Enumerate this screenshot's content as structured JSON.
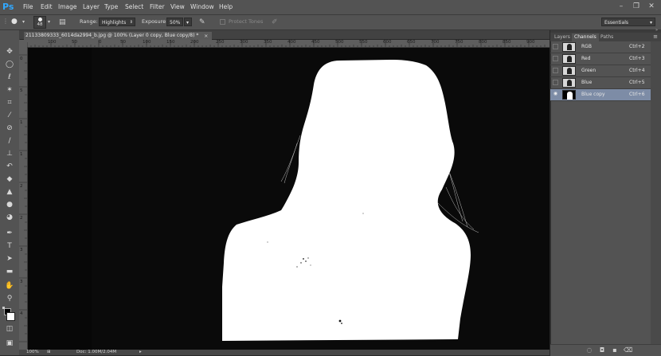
{
  "app": {
    "logo": "Ps",
    "menu": [
      "File",
      "Edit",
      "Image",
      "Layer",
      "Type",
      "Select",
      "Filter",
      "View",
      "Window",
      "Help"
    ],
    "window_controls": [
      "minimize-icon",
      "restore-icon",
      "close-icon"
    ]
  },
  "options_bar": {
    "brush_size": "48",
    "range_label": "Range:",
    "range_value": "Highlights",
    "exposure_label": "Exposure:",
    "exposure_value": "50%",
    "protect_tones_label": "Protect Tones",
    "workspace": "Essentials"
  },
  "document": {
    "tab_title": "21133809333_6014da2994_b.jpg @ 100% (Layer 0 copy, Blue copy/8) *",
    "close": "×",
    "zoom": "100%",
    "doc_info": "Doc: 1.00M/2.04M"
  },
  "ruler": {
    "top_ticks": [
      "100",
      "50",
      "0",
      "50",
      "100",
      "150",
      "200",
      "250",
      "300",
      "350",
      "400",
      "450",
      "500",
      "550",
      "600",
      "650",
      "700",
      "750",
      "800",
      "850",
      "900",
      "950"
    ],
    "left_ticks": [
      "0",
      "5",
      "1",
      "1",
      "2",
      "2",
      "3",
      "3",
      "4"
    ]
  },
  "tools": [
    "move-icon",
    "marquee-icon",
    "lasso-icon",
    "quick-select-icon",
    "crop-icon",
    "eyedropper-icon",
    "healing-icon",
    "brush-icon",
    "clone-stamp-icon",
    "history-brush-icon",
    "eraser-icon",
    "gradient-icon",
    "blur-icon",
    "dodge-icon",
    "pen-icon",
    "type-icon",
    "path-select-icon",
    "shape-icon",
    "hand-icon",
    "zoom-icon"
  ],
  "panel": {
    "tabs": [
      "Layers",
      "Channels",
      "Paths"
    ],
    "active_tab": "Channels",
    "channels": [
      {
        "name": "RGB",
        "shortcut": "Ctrl+2",
        "visible": false,
        "selected": false
      },
      {
        "name": "Red",
        "shortcut": "Ctrl+3",
        "visible": false,
        "selected": false
      },
      {
        "name": "Green",
        "shortcut": "Ctrl+4",
        "visible": false,
        "selected": false
      },
      {
        "name": "Blue",
        "shortcut": "Ctrl+5",
        "visible": false,
        "selected": false
      },
      {
        "name": "Blue copy",
        "shortcut": "Ctrl+6",
        "visible": true,
        "selected": true
      }
    ]
  },
  "colors": {
    "ui_dark": "#535353",
    "canvas_bg": "#090909",
    "mask_white": "#ffffff",
    "selected_row": "#7d8ca6",
    "ps_blue": "#31a8ff"
  }
}
